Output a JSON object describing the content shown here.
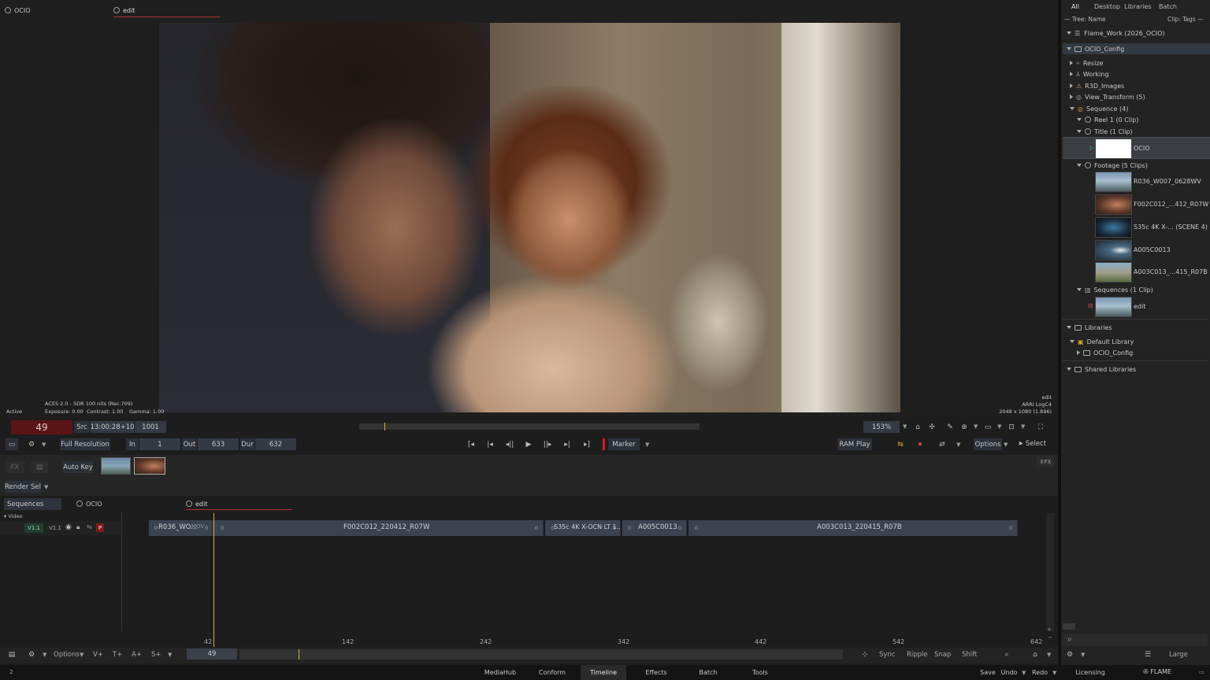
{
  "viewer": {
    "tab_left": "OCIO",
    "tab_right": "edit",
    "overlay_tl": "ACES 2.0 - SDR 100 nits (Rec.709)",
    "exposure": "Exposure: 0.00",
    "contrast": "Contrast: 1.00",
    "gamma": "Gamma: 1.00",
    "active": "Active",
    "overlay_br1": "edit",
    "overlay_br2": "ARRI LogC4",
    "overlay_br3": "2048 x 1080 (1.896)"
  },
  "transport": {
    "frame": "49",
    "src_label": "Src",
    "timecode": "13:00:28+10",
    "frame_start": "1001",
    "resolution": "Full Resolution",
    "in_label": "In",
    "in_val": "1",
    "out_label": "Out",
    "out_val": "633",
    "dur_label": "Dur",
    "dur_val": "632",
    "marker": "Marker",
    "ram_play": "RAM Play",
    "options": "Options",
    "select": "Select",
    "zoom": "153%"
  },
  "fx": {
    "fx_label": "FX",
    "auto_key": "Auto Key",
    "render_sel": "Render Sel",
    "fx_right": "FX"
  },
  "timeline": {
    "sequences": "Sequences",
    "tab_ocio": "OCIO",
    "tab_edit": "edit",
    "video": "Video",
    "track_a": "V1.1",
    "track_b": "V1.1",
    "p": "P",
    "clips": [
      {
        "name": "R036_WO...",
        "tag": "MOV",
        "z1": "0",
        "z2": "0"
      },
      {
        "name": "F002C012_220412_R07W",
        "z1": "0",
        "z2": "0"
      },
      {
        "name": "S35c 4K X-OCN LT 1...",
        "z1": "0",
        "z2": "0"
      },
      {
        "name": "A005C0013",
        "z1": "0",
        "z2": "0"
      },
      {
        "name": "A003C013_220415_R07B",
        "z1": "0",
        "z2": "0"
      }
    ],
    "ticks": [
      "42",
      "142",
      "242",
      "342",
      "442",
      "542",
      "642"
    ],
    "current": "49"
  },
  "bottom_toolbar": {
    "options": "Options",
    "v": "V+",
    "t": "T+",
    "a": "A+",
    "s": "S+",
    "sync": "Sync",
    "ripple": "Ripple",
    "snap": "Snap",
    "shift": "Shift"
  },
  "browser": {
    "tabs": [
      "All",
      "Desktop",
      "Libraries",
      "Batch"
    ],
    "tree_name": "— Tree: Name",
    "clip_tags": "Clip: Tags —",
    "items": {
      "work": "Flame_Work (2026_OCIO)",
      "config": "OCIO_Config",
      "resize": "Resize",
      "working": "Working",
      "r3d": "R3D_Images",
      "view_transform": "View_Transform (5)",
      "sequence": "Sequence (4)",
      "reel": "Reel 1 (0 Clip)",
      "title": "Title (1 Clip)",
      "ocio_clip": "OCIO",
      "footage": "Footage (5 Clips)",
      "f1": "R036_W007_0628WV",
      "f2": "F002C012_...412_R07W",
      "f3": "S35c 4K X-... (SCENE 4)",
      "f4": "A005C0013",
      "f5": "A003C013_...415_R07B",
      "sequences": "Sequences (1 Clip)",
      "edit": "edit",
      "libraries": "Libraries",
      "default_library": "Default Library",
      "lib_config": "OCIO_Config",
      "shared": "Shared Libraries"
    },
    "large": "Large"
  },
  "app_bar": {
    "tabs": [
      "MediaHub",
      "Conform",
      "Timeline",
      "Effects",
      "Batch",
      "Tools"
    ],
    "save": "Save",
    "undo": "Undo",
    "redo": "Redo",
    "licensing": "Licensing",
    "flame": "FLAME",
    "num": "2"
  }
}
